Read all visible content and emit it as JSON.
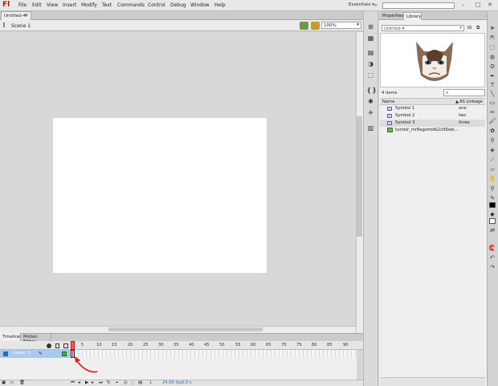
{
  "app": {
    "logo": "Fl",
    "essentials": "Essentials ▾",
    "search_placeholder": "",
    "window_controls": [
      "–",
      "□",
      "✕"
    ]
  },
  "menu": [
    "File",
    "Edit",
    "View",
    "Insert",
    "Modify",
    "Text",
    "Commands",
    "Control",
    "Debug",
    "Window",
    "Help"
  ],
  "document": {
    "tab": "Untitled-4*",
    "close": "×",
    "scene": "Scene 1",
    "zoom": "100%"
  },
  "timeline": {
    "tabs": [
      "Timeline",
      "Motion Editor"
    ],
    "layer": "Layer 1",
    "frame_marks": [
      "1",
      "5",
      "10",
      "15",
      "20",
      "25",
      "30",
      "35",
      "40",
      "45",
      "50",
      "55",
      "60",
      "65",
      "70",
      "75",
      "80",
      "85",
      "90"
    ],
    "fps": "24.00 fps",
    "time": "0.0 s",
    "current_frame": "1"
  },
  "panel": {
    "tabs": [
      "Properties",
      "Library"
    ],
    "document_select": "Untitled-4",
    "items_count": "4 items",
    "columns": {
      "name": "Name",
      "linkage": "AS Linkage"
    },
    "items": [
      {
        "name": "Symbol 1",
        "linkage": "one",
        "kind": "symbol"
      },
      {
        "name": "Symbol 2",
        "linkage": "two",
        "kind": "symbol"
      },
      {
        "name": "Symbol 3",
        "linkage": "three",
        "kind": "symbol"
      },
      {
        "name": "tumblr_mr8egzmtAG1t56wb...",
        "linkage": "",
        "kind": "bitmap"
      }
    ]
  },
  "colors": {
    "stroke": "#000000",
    "fill": "#ffffff",
    "accent": "#a61b1b"
  }
}
